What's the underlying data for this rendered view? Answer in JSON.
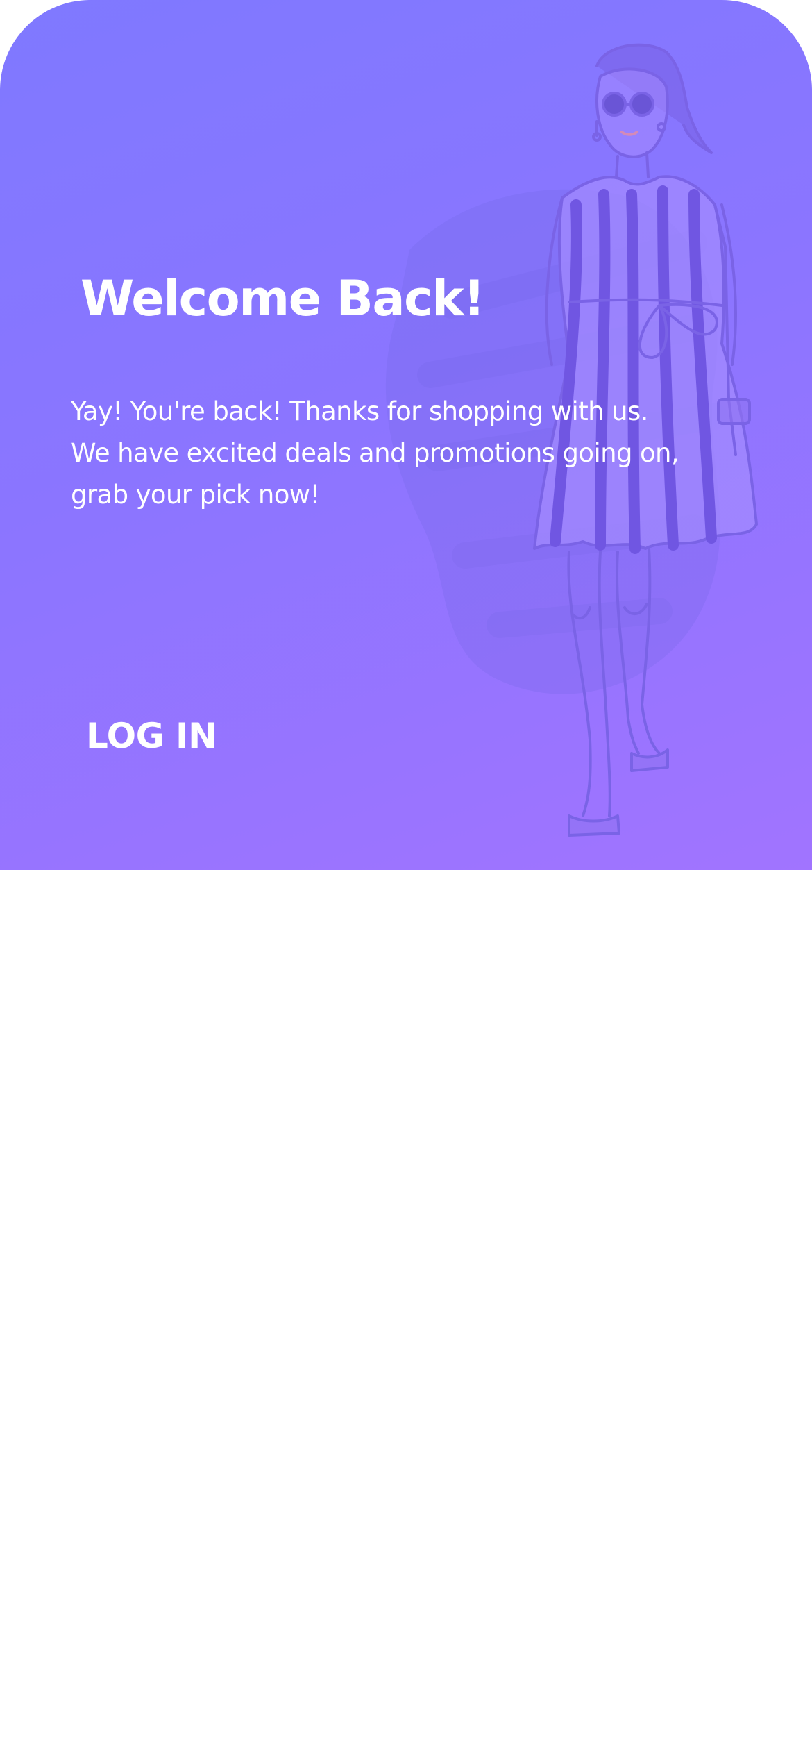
{
  "hero": {
    "title": "Welcome Back!",
    "message": "Yay! You're back! Thanks for shopping with us. We have excited deals and promotions going on, grab your pick now!",
    "login_label": "LOG IN",
    "illustration_icon": "fashion-model-illustration",
    "gradient_start": "#7f79ff",
    "gradient_end": "#a174ff"
  }
}
